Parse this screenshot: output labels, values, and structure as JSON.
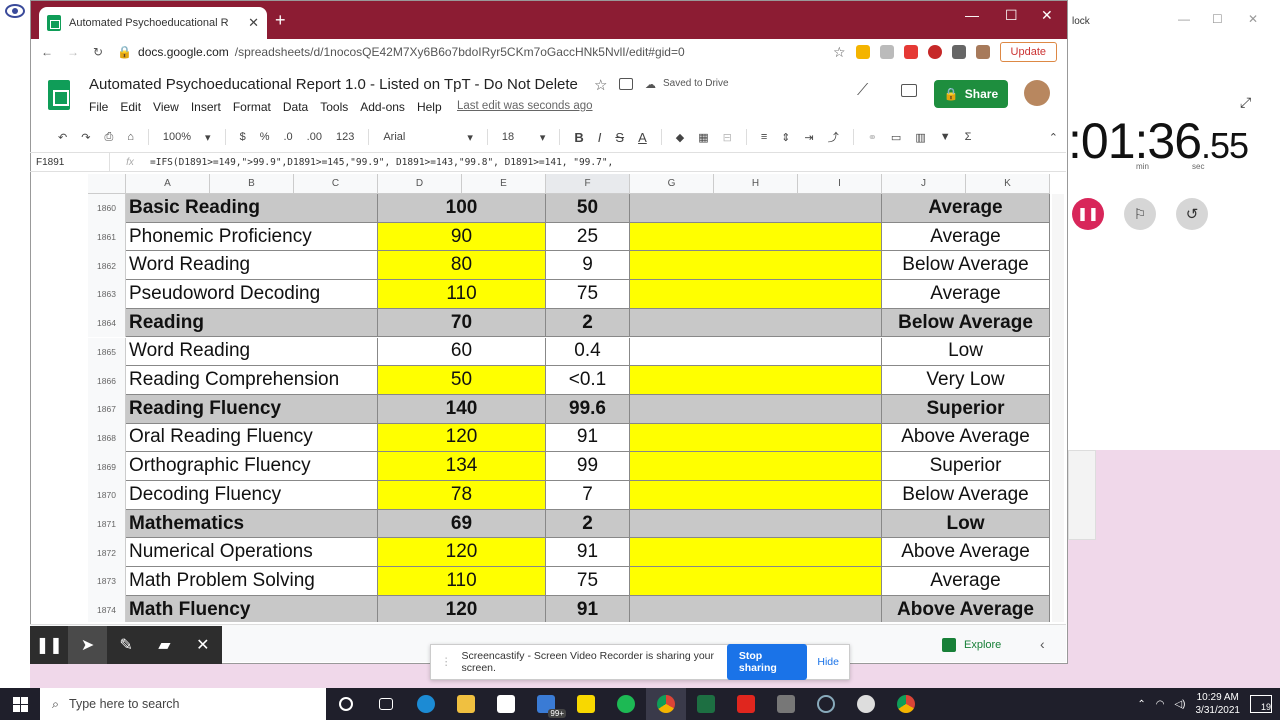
{
  "browser": {
    "tab_title": "Automated Psychoeducational R",
    "url_domain": "docs.google.com",
    "url_path": "/spreadsheets/d/1nocosQE42M7Xy6B6o7bdoIRyr5CKm7oGaccHNk5NvlI/edit#gid=0",
    "update_label": "Update"
  },
  "sheets": {
    "title": "Automated Psychoeducational Report 1.0 - Listed on TpT - Do Not Delete",
    "saved_status": "Saved to Drive",
    "last_edit": "Last edit was seconds ago",
    "share_label": "Share",
    "menu": [
      "File",
      "Edit",
      "View",
      "Insert",
      "Format",
      "Data",
      "Tools",
      "Add-ons",
      "Help"
    ],
    "toolbar": {
      "zoom": "100%",
      "currency": "$",
      "percent": "%",
      "dec_less": ".0",
      "dec_more": ".00",
      "number_format": "123",
      "font": "Arial",
      "font_size": "18",
      "bold": "B",
      "italic": "I",
      "strike": "S",
      "text_color": "A"
    },
    "name_box": "F1891",
    "formula": "=IFS(D1891>=149,\">99.9\",D1891>=145,\"99.9\", D1891>=143,\"99.8\", D1891>=141, \"99.7\",",
    "columns": [
      "A",
      "B",
      "C",
      "D",
      "E",
      "F",
      "G",
      "H",
      "I",
      "J",
      "K"
    ]
  },
  "rows": [
    {
      "n": "1860",
      "name": "Basic Reading",
      "score": "100",
      "pct": "50",
      "desc": "Average",
      "header": true,
      "yellow": false
    },
    {
      "n": "1861",
      "name": "Phonemic Proficiency",
      "score": "90",
      "pct": "25",
      "desc": "Average",
      "header": false,
      "yellow": true
    },
    {
      "n": "1862",
      "name": "Word Reading",
      "score": "80",
      "pct": "9",
      "desc": "Below Average",
      "header": false,
      "yellow": true
    },
    {
      "n": "1863",
      "name": "Pseudoword Decoding",
      "score": "110",
      "pct": "75",
      "desc": "Average",
      "header": false,
      "yellow": true
    },
    {
      "n": "1864",
      "name": "Reading",
      "score": "70",
      "pct": "2",
      "desc": "Below Average",
      "header": true,
      "yellow": false
    },
    {
      "n": "1865",
      "name": "Word Reading",
      "score": "60",
      "pct": "0.4",
      "desc": "Low",
      "header": false,
      "yellow": false
    },
    {
      "n": "1866",
      "name": "Reading Comprehension",
      "score": "50",
      "pct": "<0.1",
      "desc": "Very Low",
      "header": false,
      "yellow": true
    },
    {
      "n": "1867",
      "name": "Reading Fluency",
      "score": "140",
      "pct": "99.6",
      "desc": "Superior",
      "header": true,
      "yellow": false
    },
    {
      "n": "1868",
      "name": "Oral Reading Fluency",
      "score": "120",
      "pct": "91",
      "desc": "Above Average",
      "header": false,
      "yellow": true
    },
    {
      "n": "1869",
      "name": "Orthographic Fluency",
      "score": "134",
      "pct": "99",
      "desc": "Superior",
      "header": false,
      "yellow": true
    },
    {
      "n": "1870",
      "name": "Decoding Fluency",
      "score": "78",
      "pct": "7",
      "desc": "Below Average",
      "header": false,
      "yellow": true
    },
    {
      "n": "1871",
      "name": "Mathematics",
      "score": "69",
      "pct": "2",
      "desc": "Low",
      "header": true,
      "yellow": false
    },
    {
      "n": "1872",
      "name": "Numerical Operations",
      "score": "120",
      "pct": "91",
      "desc": "Above Average",
      "header": false,
      "yellow": true
    },
    {
      "n": "1873",
      "name": "Math Problem Solving",
      "score": "110",
      "pct": "75",
      "desc": "Average",
      "header": false,
      "yellow": true
    },
    {
      "n": "1874",
      "name": "Math Fluency",
      "score": "120",
      "pct": "91",
      "desc": "Above Average",
      "header": true,
      "yellow": false
    }
  ],
  "explore_label": "Explore",
  "share_banner": {
    "message": "Screencastify - Screen Video Recorder is sharing your screen.",
    "stop_label": "Stop sharing",
    "hide_label": "Hide"
  },
  "clock": {
    "title": "lock",
    "time_main": ":01:36",
    "time_cs": ".55",
    "min_label": "min",
    "sec_label": "sec"
  },
  "taskbar": {
    "search_placeholder": "Type here to search",
    "time": "10:29 AM",
    "date": "3/31/2021",
    "mail_badge": "99+",
    "notif_count": "19"
  },
  "colors": {
    "tabbar": "#8c1c33",
    "share_green": "#1e8e3e",
    "highlight_yellow": "#ffff00",
    "header_gray": "#c8c8c8",
    "pause_red": "#d8265a"
  }
}
